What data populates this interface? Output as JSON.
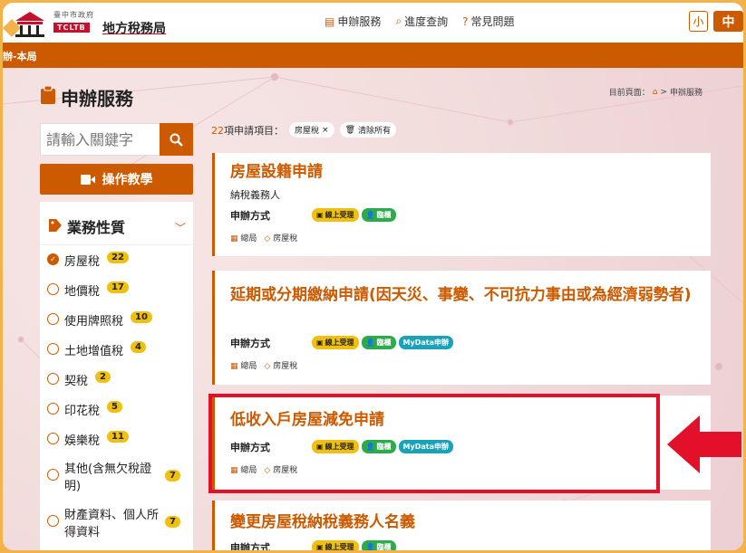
{
  "header": {
    "logo_sub": "臺中市政府",
    "logo_en": "TCLTB",
    "logo_title": "地方稅務局",
    "nav": [
      {
        "label": "申辦服務",
        "icon": "clipboard-icon"
      },
      {
        "label": "進度查詢",
        "icon": "search-icon"
      },
      {
        "label": "常見問題",
        "icon": "question-icon"
      }
    ],
    "font_small": "小",
    "font_mid": "中"
  },
  "bar": {
    "text": "辦-本局"
  },
  "page": {
    "title": "申辦服務",
    "breadcrumb_prefix": "目前頁面：",
    "breadcrumb_sep": ">",
    "breadcrumb_current": "申辦服務"
  },
  "sidebar": {
    "search_placeholder": "請輸入關鍵字",
    "tutorial_label": "操作教學",
    "filter_title": "業務性質",
    "options": [
      {
        "label": "房屋稅",
        "count": "22",
        "checked": true
      },
      {
        "label": "地價稅",
        "count": "17"
      },
      {
        "label": "使用牌照稅",
        "count": "10"
      },
      {
        "label": "土地增值稅",
        "count": "4"
      },
      {
        "label": "契稅",
        "count": "2"
      },
      {
        "label": "印花稅",
        "count": "5"
      },
      {
        "label": "娛樂稅",
        "count": "11"
      },
      {
        "label": "其他(含無欠稅證明)",
        "count": "7"
      },
      {
        "label": "財產資料、個人所得資料",
        "count": "7"
      }
    ]
  },
  "results": {
    "count": "22",
    "label": "項申請項目：",
    "chip": "房屋稅",
    "clear_label": "清除所有"
  },
  "cards": [
    {
      "title": "房屋設籍申請",
      "subtitle": "納稅義務人",
      "method_label": "申辦方式",
      "tags": [
        "線上受理",
        "臨櫃"
      ],
      "meta_office": "總局",
      "meta_tax": "房屋稅"
    },
    {
      "title": "延期或分期繳納申請(因天災、事變、不可抗力事由或為經濟弱勢者)",
      "method_label": "申辦方式",
      "tags": [
        "線上受理",
        "臨櫃",
        "MyData申辦"
      ],
      "meta_office": "總局",
      "meta_tax": "房屋稅"
    },
    {
      "title": "低收入戶房屋減免申請",
      "method_label": "申辦方式",
      "tags": [
        "線上受理",
        "臨櫃",
        "MyData申辦"
      ],
      "meta_office": "總局",
      "meta_tax": "房屋稅"
    },
    {
      "title": "變更房屋稅納稅義務人名義",
      "method_label": "申辦方式",
      "tags": [
        "線上受理",
        "臨櫃"
      ]
    }
  ],
  "colors": {
    "accent": "#cc5a00",
    "highlight": "#e3102a",
    "badge": "#f0c010"
  }
}
